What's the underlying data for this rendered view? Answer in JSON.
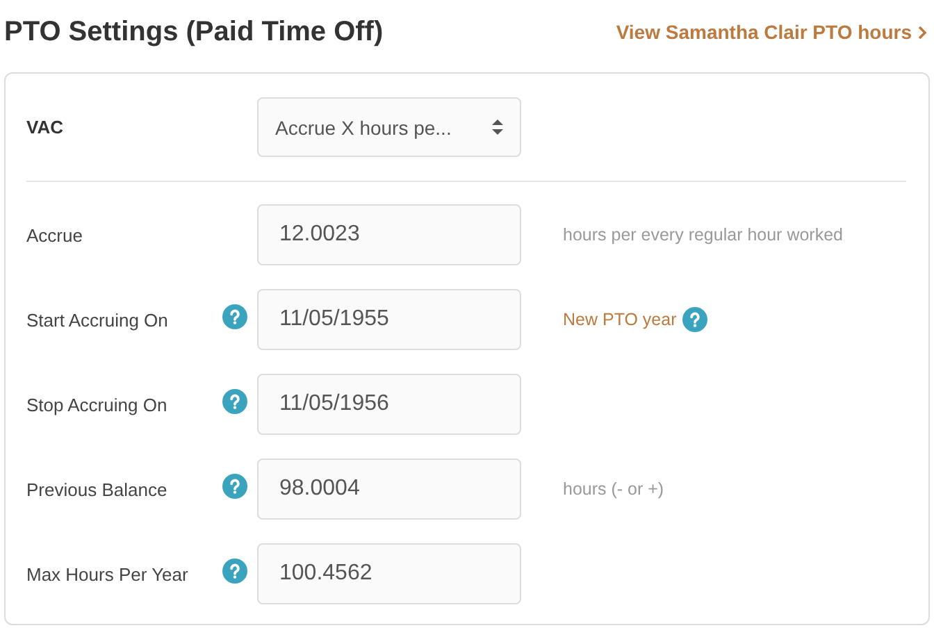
{
  "title": "PTO Settings (Paid Time Off)",
  "link": {
    "label": "View Samantha Clair PTO hours"
  },
  "policy": {
    "label": "VAC",
    "select": {
      "value": "Accrue X hours pe..."
    }
  },
  "fields": [
    {
      "label": "Accrue",
      "help": false,
      "value": "12.0023",
      "note": {
        "text": "hours per every regular hour worked",
        "kind": "hint",
        "help": false
      }
    },
    {
      "label": "Start Accruing On",
      "help": true,
      "value": "11/05/1955",
      "note": {
        "text": "New PTO year",
        "kind": "link",
        "help": true
      }
    },
    {
      "label": "Stop Accruing On",
      "help": true,
      "value": "11/05/1956"
    },
    {
      "label": "Previous Balance",
      "help": true,
      "value": "98.0004",
      "note": {
        "text": "hours (- or +)",
        "kind": "hint",
        "help": false
      }
    },
    {
      "label": "Max Hours Per Year",
      "help": true,
      "value": "100.4562"
    }
  ]
}
